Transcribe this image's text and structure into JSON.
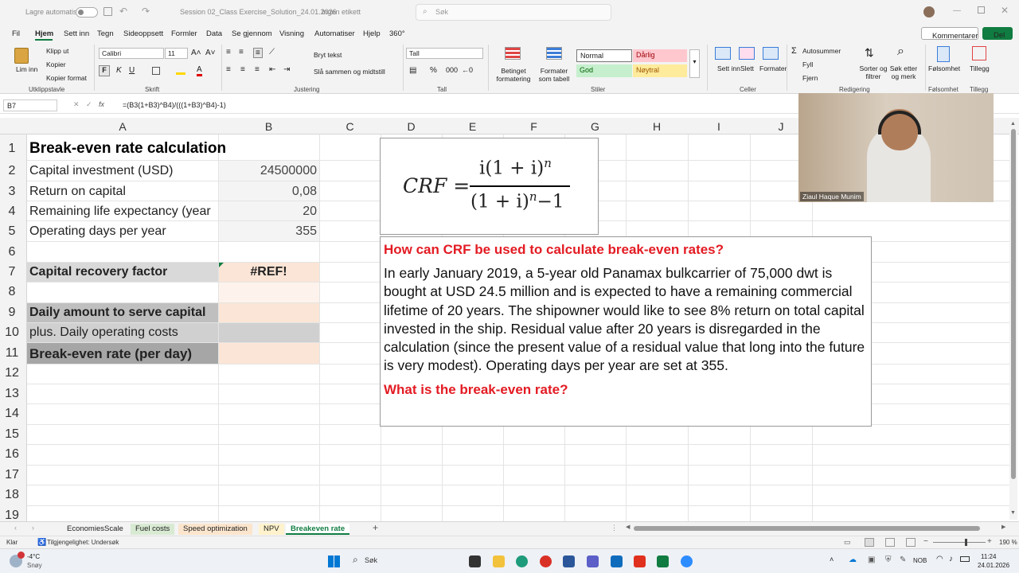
{
  "titlebar": {
    "autosave": "Lagre automatisk",
    "doc_title": "Session 02_Class Exercise_Solution_24.01.2026",
    "label": "Ingen etikett",
    "search": "Søk"
  },
  "menu": [
    "Fil",
    "Hjem",
    "Sett inn",
    "Tegn",
    "Sideoppsett",
    "Formler",
    "Data",
    "Se gjennom",
    "Visning",
    "Automatiser",
    "Hjelp",
    "360°"
  ],
  "menu_buttons": {
    "comments": "Kommentarer",
    "share": "Del"
  },
  "ribbon": {
    "paste": "Lim inn",
    "cut": "Klipp ut",
    "copy": "Kopier",
    "format_painter": "Kopier format",
    "font_name": "Calibri",
    "font_size": "11",
    "wrap": "Bryt tekst",
    "merge": "Slå sammen og midtstill",
    "number_format": "Tall",
    "cond_format": "Betinget formatering",
    "format_table": "Formater som tabell",
    "styles": {
      "normal": "Normal",
      "bad": "Dårlig",
      "good": "God",
      "neutral": "Nøytral"
    },
    "insert": "Sett inn",
    "delete": "Slett",
    "format": "Formater",
    "autosum": "Autosummer",
    "fill": "Fyll",
    "clear": "Fjern",
    "sort": "Sorter og filtrer",
    "find": "Søk etter og merk",
    "sensitivity": "Følsomhet",
    "addins": "Tillegg",
    "groups": {
      "clipboard": "Utklippstavle",
      "font": "Skrift",
      "alignment": "Justering",
      "number": "Tall",
      "styles": "Stiler",
      "cells": "Celler",
      "editing": "Redigering",
      "sensitivity": "Følsomhet",
      "addins": "Tillegg"
    }
  },
  "formula_bar": {
    "cell_ref": "B7",
    "fx": "fx",
    "formula": "=(B3(1+B3)^B4)/(((1+B3)^B4)-1)"
  },
  "columns": [
    "A",
    "B",
    "C",
    "D",
    "E",
    "F",
    "G",
    "H",
    "I",
    "J"
  ],
  "rows": [
    "1",
    "2",
    "3",
    "4",
    "5",
    "6",
    "7",
    "8",
    "9",
    "10",
    "11",
    "12",
    "13",
    "14",
    "15",
    "16",
    "17",
    "18",
    "19"
  ],
  "cells": {
    "a1": "Break-even rate calculation",
    "a2": "Capital investment (USD)",
    "b2": "24500000",
    "a3": "Return on capital",
    "b3": "0,08",
    "a4": "Remaining life expectancy (year",
    "b4": "20",
    "a5": "Operating days per year",
    "b5": "355",
    "a7": "Capital recovery factor",
    "b7": "#REF!",
    "a9": "Daily amount to serve capital",
    "a10": "plus. Daily operating costs",
    "a11": "Break-even rate (per day)"
  },
  "crf_image": {
    "lhs": "CRF =",
    "numerator": "i(1 + i)",
    "num_exp": "n",
    "denominator": "(1 + i)",
    "den_exp": "n",
    "den_tail": "−1"
  },
  "textbox": {
    "question1": "How can CRF be used to calculate break-even rates?",
    "body": "In early January 2019, a 5-year old Panamax bulkcarrier of 75,000 dwt is bought at USD 24.5 million and is expected to have a remaining commercial lifetime of 20 years. The shipowner would like to see 8% return on total capital invested in the ship. Residual value after 20 years is disregarded in the calculation (since the present value of a residual value that long into the future is very modest). Operating days per year are set at 355.",
    "question2": "What is the break-even rate?"
  },
  "video": {
    "name": "Ziaul Haque Munim"
  },
  "sheet_tabs": [
    {
      "label": "EconomiesScale",
      "color": "#f3f3f3"
    },
    {
      "label": "Fuel costs",
      "color": "#d9ead3"
    },
    {
      "label": "Speed optimization",
      "color": "#fce5cd"
    },
    {
      "label": "NPV",
      "color": "#fff2cc"
    },
    {
      "label": "Breakeven rate",
      "color": "#ffffff"
    }
  ],
  "status": {
    "ready": "Klar",
    "accessibility": "Tilgjengelighet: Undersøk",
    "zoom": "190 %"
  },
  "taskbar": {
    "temp": "-4°C",
    "weather": "Snøy",
    "search": "Søk",
    "lang": "NOB",
    "time": "11:24",
    "date": "24.01.2026"
  },
  "colors": {
    "accent": "#107c41",
    "red_text": "#e31b23",
    "row7_fill": "#d9d9d9",
    "b_fill": "#fbe5d6",
    "row9_fill": "#bfbfbf",
    "row10_fill": "#d0d0d0",
    "row11_fill": "#a6a6a6"
  }
}
